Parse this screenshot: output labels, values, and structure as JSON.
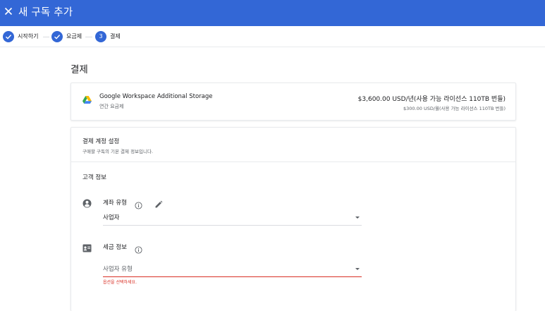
{
  "topbar": {
    "title": "새 구독 추가"
  },
  "stepper": {
    "steps": [
      {
        "label": "시작하기"
      },
      {
        "label": "요금제"
      },
      {
        "number": "3",
        "label": "결제"
      }
    ]
  },
  "page": {
    "heading": "결제"
  },
  "product": {
    "name": "Google Workspace Additional Storage",
    "plan": "연간 요금제",
    "price_main": "$3,600.00 USD/년(사용 가능 라이선스 110TB 번들)",
    "price_sub": "$300.00 USD/월(사용 가능 라이선스 110TB 번들)"
  },
  "billing": {
    "title": "결제 계정 설정",
    "subtitle": "구매할 구독의 기본 결제 정보입니다.",
    "customer_title": "고객 정보",
    "account_type": {
      "label": "계좌 유형",
      "value": "사업자"
    },
    "tax_info": {
      "label": "세금 정보",
      "placeholder": "사업자 유형",
      "error": "옵션을 선택하세요."
    }
  },
  "colors": {
    "primary": "#3367d6",
    "error": "#d93025"
  }
}
